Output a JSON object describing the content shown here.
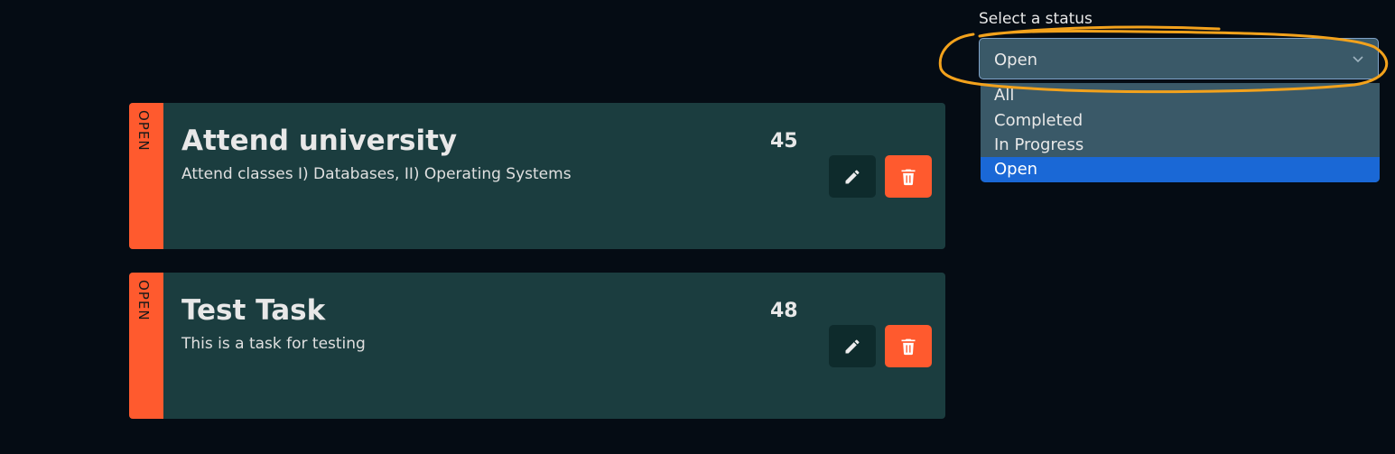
{
  "tasks": [
    {
      "status": "OPEN",
      "title": "Attend university",
      "description": "Attend classes I) Databases, II) Operating Systems",
      "id": "45"
    },
    {
      "status": "OPEN",
      "title": "Test Task",
      "description": "This is a task for testing",
      "id": "48"
    }
  ],
  "status_filter": {
    "label": "Select a status",
    "selected": "Open",
    "options": [
      "All",
      "Completed",
      "In Progress",
      "Open"
    ]
  },
  "icons": {
    "edit": "pencil-icon",
    "delete": "trash-icon",
    "select": "chevron-down-icon"
  },
  "colors": {
    "background": "#050c14",
    "card": "#1b3d3f",
    "status_open": "#ff5a2e",
    "edit_button": "#0e2b2c",
    "delete_button": "#ff5a2e",
    "select_background": "#3a5968",
    "option_highlight": "#1a68d6",
    "annotation": "#f3a21c"
  }
}
